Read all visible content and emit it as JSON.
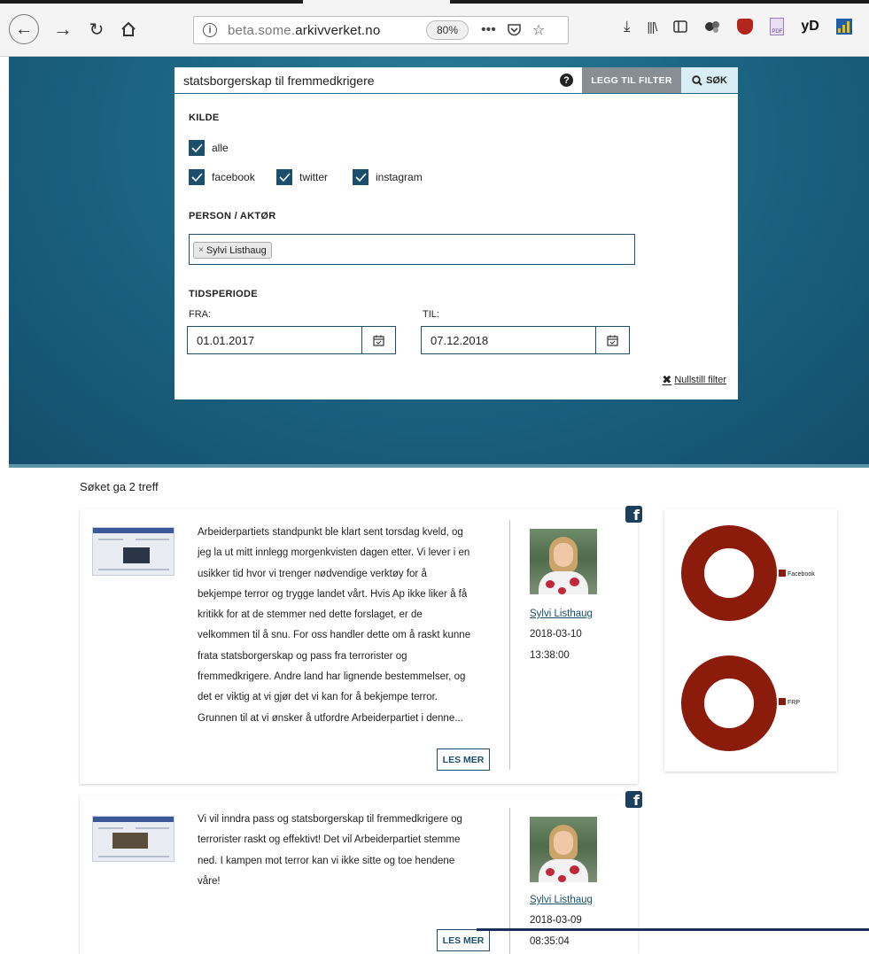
{
  "browser": {
    "url_prefix": "beta.some.",
    "url_domain": "arkivverket.no",
    "zoom": "80%",
    "extension_yd": "yD"
  },
  "search": {
    "query": "statsborgerskap til fremmedkrigere",
    "add_filter_label": "LEGG TIL FILTER",
    "search_label": "SØK"
  },
  "filters": {
    "source_title": "KILDE",
    "sources": [
      {
        "label": "alle",
        "checked": true
      },
      {
        "label": "facebook",
        "checked": true
      },
      {
        "label": "twitter",
        "checked": true
      },
      {
        "label": "instagram",
        "checked": true
      }
    ],
    "person_title": "PERSON / AKTØR",
    "person_tag": "Sylvi Listhaug",
    "period_title": "TIDSPERIODE",
    "from_label": "FRA:",
    "from_value": "01.01.2017",
    "to_label": "TIL:",
    "to_value": "07.12.2018",
    "reset_label": "Nullstill filter"
  },
  "results": {
    "count_text": "Søket ga 2 treff",
    "read_more_label": "LES MER",
    "items": [
      {
        "lines": [
          "Arbeiderpartiets standpunkt ble klart sent torsdag kveld, og",
          "jeg la ut mitt innlegg morgenkvisten dagen etter. Vi lever i en",
          "usikker tid hvor vi trenger nødvendige verktøy for å",
          "bekjempe terror og trygge landet vårt. Hvis Ap ikke liker å få",
          "kritikk for at de stemmer ned dette forslaget, er de",
          "velkommen til å snu. For oss handler dette om å raskt kunne",
          "frata statsborgerskap og pass fra terrorister og",
          "fremmedkrigere. Andre land har lignende bestemmelser, og",
          "det er viktig at vi gjør det vi kan for å bekjempe terror.",
          "Grunnen til at vi ønsker å utfordre Arbeiderpartiet i denne..."
        ],
        "author": "Sylvi Listhaug",
        "date": "2018-03-10",
        "time": "13:38:00",
        "platform_icon": "facebook-icon"
      },
      {
        "lines": [
          "Vi vil inndra pass og statsborgerskap til fremmedkrigere og",
          "terrorister raskt og effektivt! Det vil Arbeiderpartiet stemme",
          "ned. I kampen mot terror kan vi ikke sitte og toe hendene",
          "våre!"
        ],
        "author": "Sylvi Listhaug",
        "date": "2018-03-09",
        "time": "08:35:04",
        "platform_icon": "facebook-icon"
      }
    ]
  },
  "charts": {
    "platform_legend": "Facebook",
    "party_legend": "FRP",
    "color": "#8b1c0c"
  }
}
